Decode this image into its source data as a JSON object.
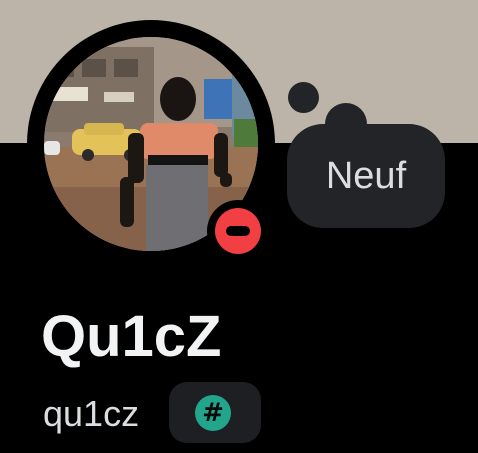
{
  "profile": {
    "display_name": "Qu1cZ",
    "username": "qu1cz",
    "status": "do-not-disturb",
    "custom_status": "Neuf",
    "badge_icon": "hash-icon",
    "badge_symbol": "#"
  },
  "colors": {
    "banner": "#bcb4a8",
    "background": "#000000",
    "status_dnd": "#f23f43",
    "bubble": "#232428",
    "badge_bg": "#1e1f22",
    "badge_icon": "#23a58c"
  }
}
